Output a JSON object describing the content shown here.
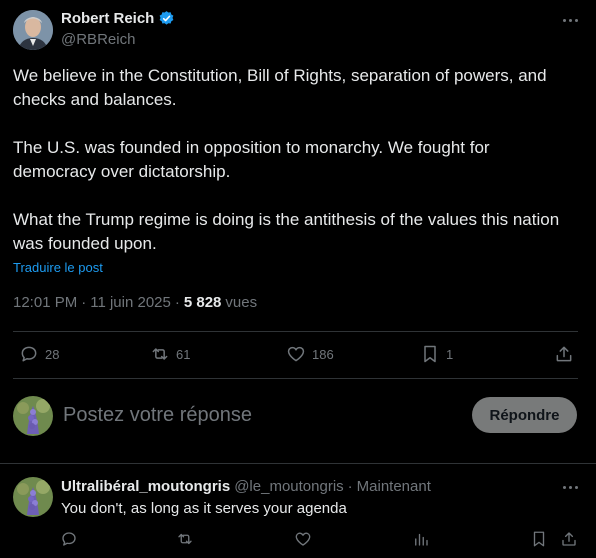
{
  "post": {
    "author_name": "Robert Reich",
    "author_handle": "@RBReich",
    "paragraphs": [
      "We believe in the Constitution, Bill of Rights, separation of powers, and checks and balances.",
      "The U.S. was founded in opposition to monarchy. We fought for democracy over dictatorship.",
      "What the Trump regime is doing is the antithesis of the values this nation was founded upon."
    ],
    "translate_link": "Traduire le post",
    "time": "12:01 PM",
    "date": "11 juin 2025",
    "separator": "·",
    "views_count": "5 828",
    "views_label": "vues",
    "more_icon": "more-horizontal-icon",
    "verified_icon": "verified-badge-icon"
  },
  "actions": {
    "replies": "28",
    "reposts": "61",
    "likes": "186",
    "bookmarks": "1"
  },
  "compose": {
    "placeholder": "Postez votre réponse",
    "reply_button": "Répondre"
  },
  "reply": {
    "author_name": "Ultralibéral_moutongris",
    "author_handle": "@le_moutongris",
    "separator": "·",
    "time": "Maintenant",
    "text": "You don't, as long as it serves your agenda"
  },
  "colors": {
    "background": "#000000",
    "text": "#e7e9ea",
    "muted": "#71767b",
    "link": "#1d9bf0",
    "divider": "#2f3336",
    "button_bg": "#787a7a"
  }
}
